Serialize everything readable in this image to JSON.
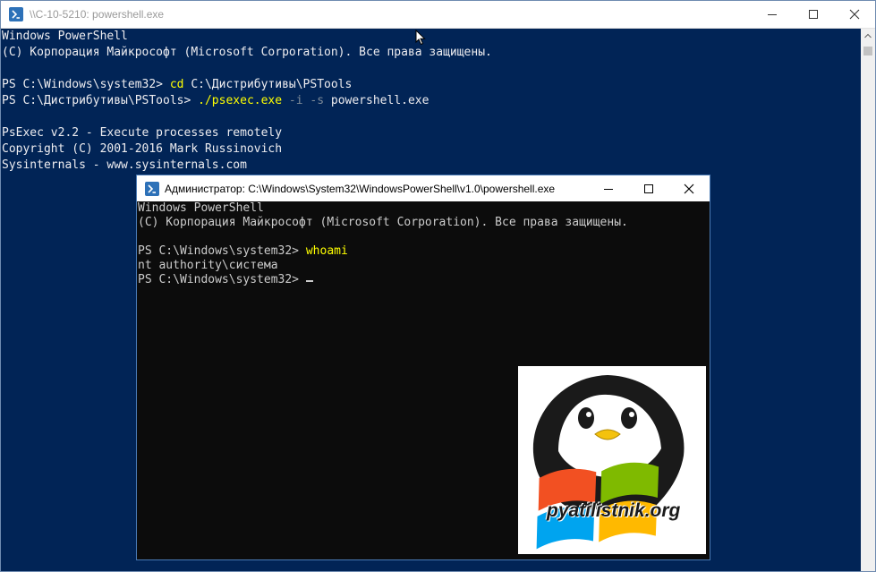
{
  "outer_window": {
    "title": "\\\\C-10-5210: powershell.exe",
    "console": {
      "banner_1": "Windows PowerShell",
      "banner_2": "(C) Корпорация Майкрософт (Microsoft Corporation). Все права защищены.",
      "prompt_1": "PS C:\\Windows\\system32> ",
      "cmd_1": "cd",
      "arg_1": " C:\\Дистрибутивы\\PSTools",
      "prompt_2": "PS C:\\Дистрибутивы\\PSTools> ",
      "cmd_2": "./psexec.exe",
      "param_1": " -i",
      "param_2": " -s",
      "arg_2": " powershell.exe",
      "psexec_1": "PsExec v2.2 - Execute processes remotely",
      "psexec_2": "Copyright (C) 2001-2016 Mark Russinovich",
      "psexec_3": "Sysinternals - www.sysinternals.com"
    }
  },
  "inner_window": {
    "title": "Администратор: C:\\Windows\\System32\\WindowsPowerShell\\v1.0\\powershell.exe",
    "console": {
      "banner_1": "Windows PowerShell",
      "banner_2": "(C) Корпорация Майкрософт (Microsoft Corporation). Все права защищены.",
      "prompt_1": "PS C:\\Windows\\system32> ",
      "cmd_1": "whoami",
      "output_1": "nt authority\\система",
      "prompt_2": "PS C:\\Windows\\system32> "
    }
  },
  "logo": {
    "text": "pyatilistnik.org"
  },
  "icons": {
    "app": "powershell-icon",
    "minimize": "minimize-icon",
    "maximize": "maximize-icon",
    "close": "close-icon",
    "cursor": "mouse-pointer-icon"
  },
  "colors": {
    "outer_background": "#012456",
    "inner_background": "#0c0c0c",
    "command": "#ffff00",
    "parameter": "#7f8c99"
  }
}
